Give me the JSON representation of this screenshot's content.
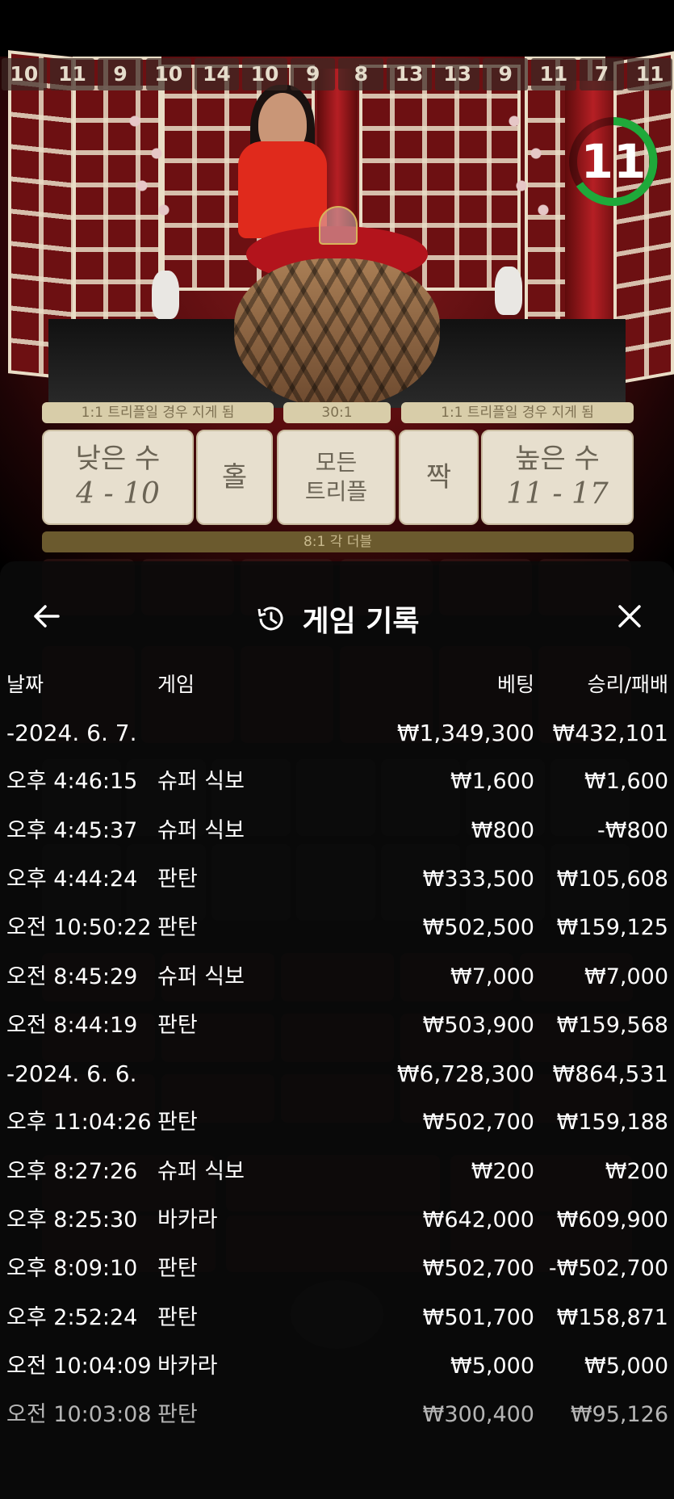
{
  "live": {
    "recent_results": [
      "10",
      "11",
      "9",
      "10",
      "14",
      "10",
      "9",
      "8",
      "13",
      "13",
      "9",
      "11",
      "7",
      "11"
    ],
    "timer": "11",
    "timer_color": "#1fa93a",
    "payout_low": "1:1 트리플일 경우 지게 됨",
    "payout_triple": "30:1",
    "payout_high": "1:1 트리플일 경우 지게 됨",
    "bets": {
      "low_label": "낮은 수",
      "low_range": "4 - 10",
      "odd_label": "홀",
      "any_triple_line1": "모든",
      "any_triple_line2": "트리플",
      "even_label": "짝",
      "high_label": "높은 수",
      "high_range": "11 - 17"
    },
    "double_payout": "8:1 각 더블"
  },
  "panel": {
    "title": "게임 기록",
    "columns": {
      "date": "날짜",
      "game": "게임",
      "bet": "베팅",
      "win_loss": "승리/패배"
    },
    "rows": [
      {
        "type": "day",
        "date": "-2024. 6. 7.",
        "game": "",
        "bet": "₩1,349,300",
        "result": "₩432,101"
      },
      {
        "type": "entry",
        "date": "오후 4:46:15",
        "game": "슈퍼 식보",
        "bet": "₩1,600",
        "result": "₩1,600"
      },
      {
        "type": "entry",
        "date": "오후 4:45:37",
        "game": "슈퍼 식보",
        "bet": "₩800",
        "result": "-₩800"
      },
      {
        "type": "entry",
        "date": "오후 4:44:24",
        "game": "판탄",
        "bet": "₩333,500",
        "result": "₩105,608"
      },
      {
        "type": "entry",
        "date": "오전 10:50:22",
        "game": "판탄",
        "bet": "₩502,500",
        "result": "₩159,125"
      },
      {
        "type": "entry",
        "date": "오전 8:45:29",
        "game": "슈퍼 식보",
        "bet": "₩7,000",
        "result": "₩7,000"
      },
      {
        "type": "entry",
        "date": "오전 8:44:19",
        "game": "판탄",
        "bet": "₩503,900",
        "result": "₩159,568"
      },
      {
        "type": "day",
        "date": "-2024. 6. 6.",
        "game": "",
        "bet": "₩6,728,300",
        "result": "₩864,531"
      },
      {
        "type": "entry",
        "date": "오후 11:04:26",
        "game": "판탄",
        "bet": "₩502,700",
        "result": "₩159,188"
      },
      {
        "type": "entry",
        "date": "오후 8:27:26",
        "game": "슈퍼 식보",
        "bet": "₩200",
        "result": "₩200"
      },
      {
        "type": "entry",
        "date": "오후 8:25:30",
        "game": "바카라",
        "bet": "₩642,000",
        "result": "₩609,900"
      },
      {
        "type": "entry",
        "date": "오후 8:09:10",
        "game": "판탄",
        "bet": "₩502,700",
        "result": "-₩502,700"
      },
      {
        "type": "entry",
        "date": "오후 2:52:24",
        "game": "판탄",
        "bet": "₩501,700",
        "result": "₩158,871"
      },
      {
        "type": "entry",
        "date": "오전 10:04:09",
        "game": "바카라",
        "bet": "₩5,000",
        "result": "₩5,000"
      },
      {
        "type": "entry",
        "date": "오전 10:03:08",
        "game": "판탄",
        "bet": "₩300,400",
        "result": "₩95,126"
      }
    ]
  }
}
